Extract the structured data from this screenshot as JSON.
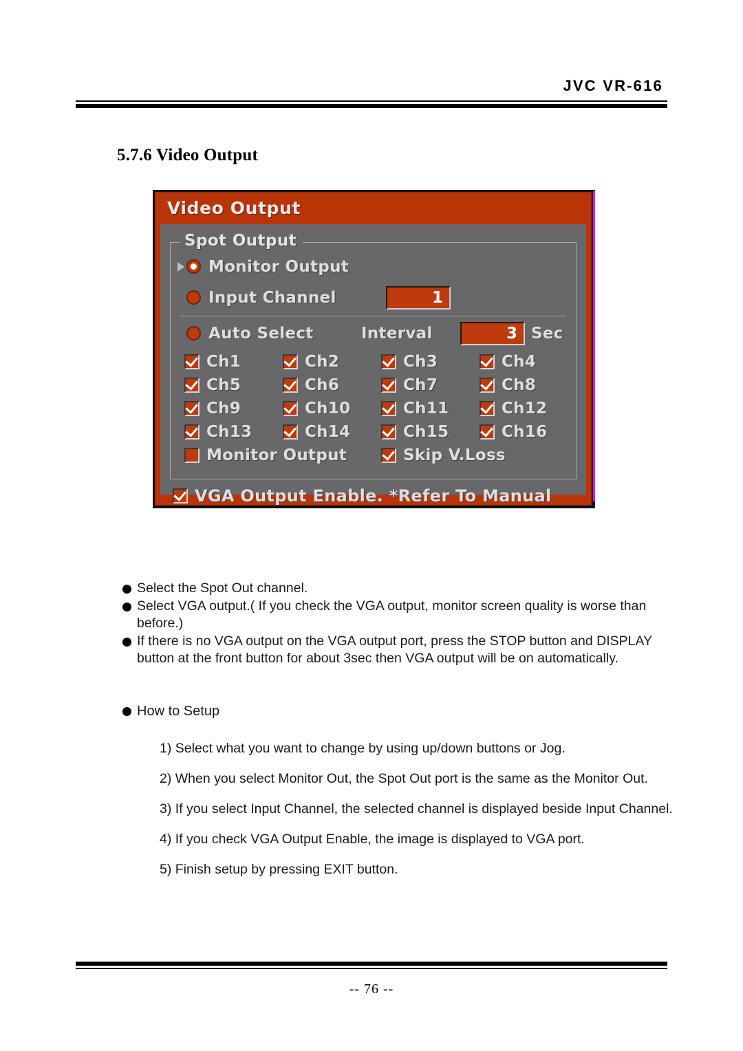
{
  "header": {
    "title": "JVC VR-616"
  },
  "section": {
    "heading": "5.7.6 Video Output"
  },
  "osd": {
    "window_title": "Video Output",
    "group_legend": "Spot Output",
    "rows": {
      "monitor_output_label": "Monitor Output",
      "monitor_output_selected": true,
      "input_channel_label": "Input Channel",
      "input_channel_selected": false,
      "input_channel_value": "1",
      "auto_select_label": "Auto Select",
      "auto_select_selected": false,
      "interval_label": "Interval",
      "interval_value": "3",
      "interval_unit": "Sec"
    },
    "channels": [
      {
        "label": "Ch1",
        "checked": true
      },
      {
        "label": "Ch2",
        "checked": true
      },
      {
        "label": "Ch3",
        "checked": true
      },
      {
        "label": "Ch4",
        "checked": true
      },
      {
        "label": "Ch5",
        "checked": true
      },
      {
        "label": "Ch6",
        "checked": true
      },
      {
        "label": "Ch7",
        "checked": true
      },
      {
        "label": "Ch8",
        "checked": true
      },
      {
        "label": "Ch9",
        "checked": true
      },
      {
        "label": "Ch10",
        "checked": true
      },
      {
        "label": "Ch11",
        "checked": true
      },
      {
        "label": "Ch12",
        "checked": true
      },
      {
        "label": "Ch13",
        "checked": true
      },
      {
        "label": "Ch14",
        "checked": true
      },
      {
        "label": "Ch15",
        "checked": true
      },
      {
        "label": "Ch16",
        "checked": true
      }
    ],
    "bottom_options": [
      {
        "label": "Monitor Output",
        "checked": false
      },
      {
        "label": "Skip V.Loss",
        "checked": true
      }
    ],
    "vga": {
      "label": "VGA Output Enable. *Refer To Manual",
      "checked": true
    },
    "colors": {
      "orange": "#bf3a0d",
      "panel_gray": "#68686b",
      "text": "#dedede",
      "frame_magenta": "#e313e3"
    }
  },
  "bullets": [
    "Select the Spot Out channel.",
    "Select VGA output.( If you check the VGA output, monitor screen quality is worse than before.)",
    "If there is no VGA output on the VGA output port, press the STOP button and DISPLAY button at the front button for about 3sec then VGA output will be on automatically."
  ],
  "howto": {
    "heading": "How to Setup",
    "steps": [
      "1) Select what you want to change by using up/down buttons or Jog.",
      "2) When you select Monitor Out, the Spot Out port is the same as the Monitor Out.",
      "3) If you select Input Channel, the selected channel is displayed beside Input Channel.",
      "4) If you check VGA Output Enable, the image is displayed to VGA port.",
      "5) Finish setup by pressing EXIT button."
    ]
  },
  "footer": {
    "page_number": "-- 76 --"
  }
}
